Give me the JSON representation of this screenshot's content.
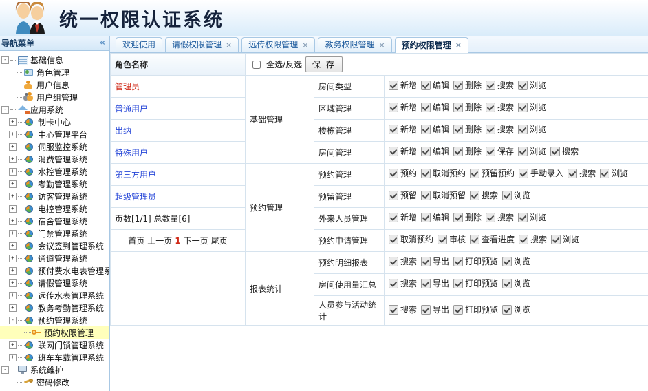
{
  "header": {
    "title": "统一权限认证系统",
    "logo_icon": "people-logo-icon"
  },
  "sidebar": {
    "title": "导航菜单",
    "collapse_icon": "«",
    "items": [
      {
        "label": "基础信息",
        "level": 0,
        "expander": "-",
        "icon": "window-icon",
        "selected": false
      },
      {
        "label": "角色管理",
        "level": 1,
        "expander": "",
        "icon": "role-icon",
        "selected": false
      },
      {
        "label": "用户信息",
        "level": 1,
        "expander": "",
        "icon": "person-icon",
        "selected": false
      },
      {
        "label": "用户组管理",
        "level": 1,
        "expander": "",
        "icon": "group-icon",
        "selected": false
      },
      {
        "label": "应用系统",
        "level": 0,
        "expander": "-",
        "icon": "house-icon",
        "selected": false
      },
      {
        "label": "制卡中心",
        "level": 1,
        "expander": "+",
        "icon": "pie-icon",
        "selected": false
      },
      {
        "label": "中心管理平台",
        "level": 1,
        "expander": "+",
        "icon": "pie-icon",
        "selected": false
      },
      {
        "label": "伺服监控系统",
        "level": 1,
        "expander": "+",
        "icon": "pie-icon",
        "selected": false
      },
      {
        "label": "消费管理系统",
        "level": 1,
        "expander": "+",
        "icon": "pie-icon",
        "selected": false
      },
      {
        "label": "水控管理系统",
        "level": 1,
        "expander": "+",
        "icon": "pie-icon",
        "selected": false
      },
      {
        "label": "考勤管理系统",
        "level": 1,
        "expander": "+",
        "icon": "pie-icon",
        "selected": false
      },
      {
        "label": "访客管理系统",
        "level": 1,
        "expander": "+",
        "icon": "pie-icon",
        "selected": false
      },
      {
        "label": "电控管理系统",
        "level": 1,
        "expander": "+",
        "icon": "pie-icon",
        "selected": false
      },
      {
        "label": "宿舍管理系统",
        "level": 1,
        "expander": "+",
        "icon": "pie-icon",
        "selected": false
      },
      {
        "label": "门禁管理系统",
        "level": 1,
        "expander": "+",
        "icon": "pie-icon",
        "selected": false
      },
      {
        "label": "会议签到管理系统",
        "level": 1,
        "expander": "+",
        "icon": "pie-icon",
        "selected": false
      },
      {
        "label": "通道管理系统",
        "level": 1,
        "expander": "+",
        "icon": "pie-icon",
        "selected": false
      },
      {
        "label": "预付费水电表管理系统",
        "level": 1,
        "expander": "+",
        "icon": "pie-icon",
        "selected": false
      },
      {
        "label": "请假管理系统",
        "level": 1,
        "expander": "+",
        "icon": "pie-icon",
        "selected": false
      },
      {
        "label": "远传水表管理系统",
        "level": 1,
        "expander": "+",
        "icon": "pie-icon",
        "selected": false
      },
      {
        "label": "教务考勤管理系统",
        "level": 1,
        "expander": "+",
        "icon": "pie-icon",
        "selected": false
      },
      {
        "label": "预约管理系统",
        "level": 1,
        "expander": "-",
        "icon": "pie-icon",
        "selected": false
      },
      {
        "label": "预约权限管理",
        "level": 2,
        "expander": "",
        "icon": "key-icon",
        "selected": true
      },
      {
        "label": "联网门锁管理系统",
        "level": 1,
        "expander": "+",
        "icon": "pie-icon",
        "selected": false
      },
      {
        "label": "班车车载管理系统",
        "level": 1,
        "expander": "+",
        "icon": "pie-icon",
        "selected": false
      },
      {
        "label": "系统维护",
        "level": 0,
        "expander": "-",
        "icon": "monitor-icon",
        "selected": false
      },
      {
        "label": "密码修改",
        "level": 1,
        "expander": "",
        "icon": "wrench-icon",
        "selected": false
      }
    ]
  },
  "tabs": [
    {
      "label": "欢迎使用",
      "closable": false,
      "active": false
    },
    {
      "label": "请假权限管理",
      "closable": true,
      "active": false
    },
    {
      "label": "远传权限管理",
      "closable": true,
      "active": false
    },
    {
      "label": "教务权限管理",
      "closable": true,
      "active": false
    },
    {
      "label": "预约权限管理",
      "closable": true,
      "active": true
    }
  ],
  "role_panel": {
    "column_header": "角色名称",
    "roles": [
      {
        "name": "管理员",
        "active": true
      },
      {
        "name": "普通用户",
        "active": false
      },
      {
        "name": "出纳",
        "active": false
      },
      {
        "name": "特殊用户",
        "active": false
      },
      {
        "name": "第三方用户",
        "active": false
      },
      {
        "name": "超级管理员",
        "active": false
      }
    ],
    "page_info": "页数[1/1]  总数量[6]",
    "pager": {
      "first": "首页",
      "prev": "上一页",
      "current": "1",
      "next": "下一页",
      "last": "尾页"
    }
  },
  "toolbar": {
    "select_all_label": "全选/反选",
    "select_all_checked": false,
    "save_label": "保 存"
  },
  "permissions": [
    {
      "group": "基础管理",
      "modules": [
        {
          "name": "房间类型",
          "actions": [
            "新增",
            "编辑",
            "删除",
            "搜索",
            "浏览"
          ],
          "checked": [
            true,
            true,
            true,
            true,
            true
          ]
        },
        {
          "name": "区域管理",
          "actions": [
            "新增",
            "编辑",
            "删除",
            "搜索",
            "浏览"
          ],
          "checked": [
            true,
            true,
            true,
            true,
            true
          ]
        },
        {
          "name": "楼栋管理",
          "actions": [
            "新增",
            "编辑",
            "删除",
            "搜索",
            "浏览"
          ],
          "checked": [
            true,
            true,
            true,
            true,
            true
          ]
        },
        {
          "name": "房间管理",
          "actions": [
            "新增",
            "编辑",
            "删除",
            "保存",
            "浏览",
            "搜索"
          ],
          "checked": [
            true,
            true,
            true,
            true,
            true,
            true
          ]
        }
      ]
    },
    {
      "group": "预约管理",
      "modules": [
        {
          "name": "预约管理",
          "actions": [
            "预约",
            "取消预约",
            "预留预约",
            "手动录入",
            "搜索",
            "浏览"
          ],
          "checked": [
            true,
            true,
            true,
            true,
            true,
            true
          ]
        },
        {
          "name": "预留管理",
          "actions": [
            "预留",
            "取消预留",
            "搜索",
            "浏览"
          ],
          "checked": [
            true,
            true,
            true,
            true
          ]
        },
        {
          "name": "外来人员管理",
          "actions": [
            "新增",
            "编辑",
            "删除",
            "搜索",
            "浏览"
          ],
          "checked": [
            true,
            true,
            true,
            true,
            true
          ]
        },
        {
          "name": "预约申请管理",
          "actions": [
            "取消预约",
            "审核",
            "查看进度",
            "搜索",
            "浏览"
          ],
          "checked": [
            true,
            true,
            true,
            true,
            true
          ]
        }
      ]
    },
    {
      "group": "报表统计",
      "modules": [
        {
          "name": "预约明细报表",
          "actions": [
            "搜索",
            "导出",
            "打印预览",
            "浏览"
          ],
          "checked": [
            true,
            true,
            true,
            true
          ]
        },
        {
          "name": "房间使用量汇总",
          "actions": [
            "搜索",
            "导出",
            "打印预览",
            "浏览"
          ],
          "checked": [
            true,
            true,
            true,
            true
          ]
        },
        {
          "name": "人员参与活动统计",
          "actions": [
            "搜索",
            "导出",
            "打印预览",
            "浏览"
          ],
          "checked": [
            true,
            true,
            true,
            true
          ]
        }
      ]
    }
  ]
}
